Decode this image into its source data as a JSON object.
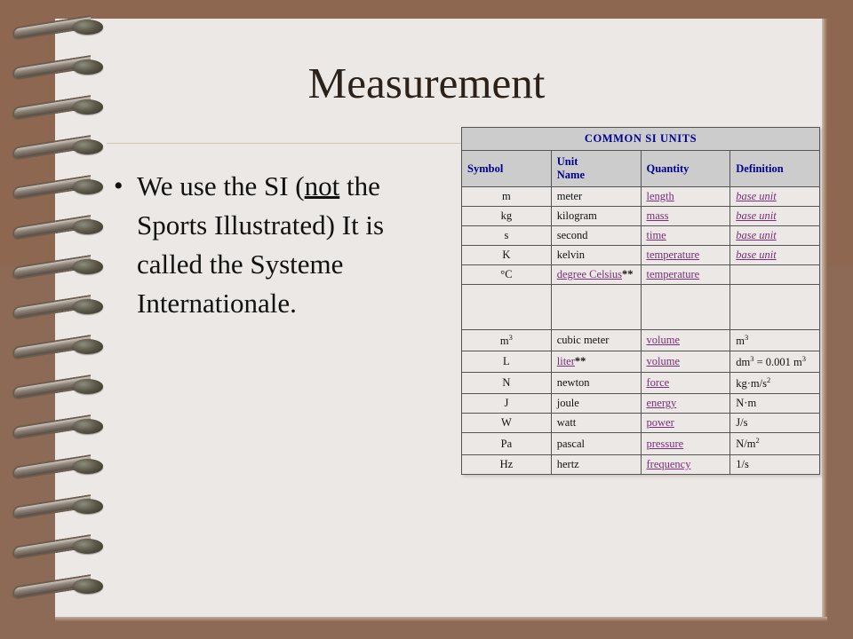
{
  "slide": {
    "title": "Measurement",
    "theme": {
      "border_color": "#8d6a55",
      "page_color": "#ece8e5",
      "header_cell_color": "#cccccc",
      "header_text_color": "#00008f",
      "link_color": "#7a2d7a",
      "body_text_color": "#111111"
    },
    "bullets": [
      {
        "dot": "•",
        "segments": [
          {
            "text": "We use the SI (",
            "underline": false
          },
          {
            "text": "not",
            "underline": true
          },
          {
            "text": " the Sports Illustrated) It is called the Systeme Internationale.",
            "underline": false
          }
        ]
      }
    ]
  },
  "table": {
    "caption": "COMMON SI UNITS",
    "columns": [
      "Symbol",
      "Unit Name",
      "Quantity",
      "Definition"
    ],
    "rows": [
      {
        "symbol": "m",
        "symbol_sup": "",
        "unit": "meter",
        "unit_link": false,
        "unit_note": "",
        "quantity": "length",
        "definition": "base unit",
        "definition_link": true,
        "definition_sup": ""
      },
      {
        "symbol": "kg",
        "symbol_sup": "",
        "unit": "kilogram",
        "unit_link": false,
        "unit_note": "",
        "quantity": "mass",
        "definition": "base unit",
        "definition_link": true,
        "definition_sup": ""
      },
      {
        "symbol": "s",
        "symbol_sup": "",
        "unit": "second",
        "unit_link": false,
        "unit_note": "",
        "quantity": "time",
        "definition": "base unit",
        "definition_link": true,
        "definition_sup": ""
      },
      {
        "symbol": "K",
        "symbol_sup": "",
        "unit": "kelvin",
        "unit_link": false,
        "unit_note": "",
        "quantity": "temperature",
        "definition": "base unit",
        "definition_link": true,
        "definition_sup": ""
      },
      {
        "symbol": "°C",
        "symbol_sup": "",
        "unit": "degree Celsius",
        "unit_link": true,
        "unit_note": "**",
        "quantity": "temperature",
        "definition": "",
        "definition_link": false,
        "definition_sup": ""
      },
      {
        "symbol": "",
        "symbol_sup": "",
        "unit": "",
        "unit_link": false,
        "unit_note": "",
        "quantity": "",
        "definition": "",
        "definition_link": false,
        "definition_sup": "",
        "empty": true
      },
      {
        "symbol": "m",
        "symbol_sup": "3",
        "unit": "cubic meter",
        "unit_link": false,
        "unit_note": "",
        "quantity": "volume",
        "definition": "m",
        "definition_link": false,
        "definition_sup": "3"
      },
      {
        "symbol": "L",
        "symbol_sup": "",
        "unit": "liter",
        "unit_link": true,
        "unit_note": "**",
        "quantity": "volume",
        "definition": "dm³ = 0.001 m³",
        "definition_link": false,
        "definition_sup": "",
        "definition_html": true
      },
      {
        "symbol": "N",
        "symbol_sup": "",
        "unit": "newton",
        "unit_link": false,
        "unit_note": "",
        "quantity": "force",
        "definition": "kg·m/s",
        "definition_link": false,
        "definition_sup": "2"
      },
      {
        "symbol": "J",
        "symbol_sup": "",
        "unit": "joule",
        "unit_link": false,
        "unit_note": "",
        "quantity": "energy",
        "definition": "N·m",
        "definition_link": false,
        "definition_sup": ""
      },
      {
        "symbol": "W",
        "symbol_sup": "",
        "unit": "watt",
        "unit_link": false,
        "unit_note": "",
        "quantity": "power",
        "definition": "J/s",
        "definition_link": false,
        "definition_sup": ""
      },
      {
        "symbol": "Pa",
        "symbol_sup": "",
        "unit": "pascal",
        "unit_link": false,
        "unit_note": "",
        "quantity": "pressure",
        "definition": "N/m",
        "definition_link": false,
        "definition_sup": "2"
      },
      {
        "symbol": "Hz",
        "symbol_sup": "",
        "unit": "hertz",
        "unit_link": false,
        "unit_note": "",
        "quantity": "frequency",
        "definition": "1/s",
        "definition_link": false,
        "definition_sup": ""
      }
    ]
  },
  "decor": {
    "spiral_ring_count": 15,
    "spiral_icon": "spiral-ring-icon"
  }
}
